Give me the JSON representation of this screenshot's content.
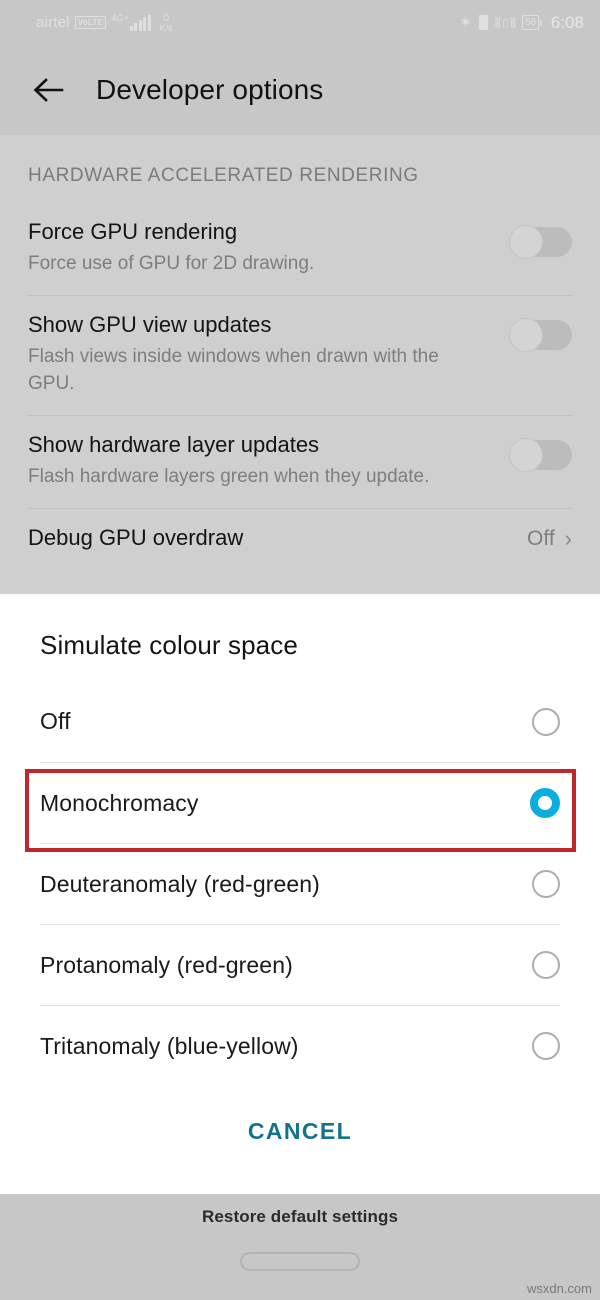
{
  "status_bar": {
    "carrier": "airtel",
    "volte_badge": "VoLTE",
    "network_type": "4G+",
    "data_speed_value": "0",
    "data_speed_unit": "K/s",
    "bluetooth_icon": "bluetooth-icon",
    "sim_icon": "sim-card-icon",
    "vibrate_icon": "vibrate-icon",
    "battery_level": "58",
    "clock": "6:08"
  },
  "app_bar": {
    "back_icon": "back-arrow-icon",
    "title": "Developer options"
  },
  "settings": {
    "section_header": "HARDWARE ACCELERATED RENDERING",
    "rows": [
      {
        "title": "Force GPU rendering",
        "subtitle": "Force use of GPU for 2D drawing.",
        "control": "toggle",
        "state": "off"
      },
      {
        "title": "Show GPU view updates",
        "subtitle": "Flash views inside windows when drawn with the GPU.",
        "control": "toggle",
        "state": "off"
      },
      {
        "title": "Show hardware layer updates",
        "subtitle": "Flash hardware layers green when they update.",
        "control": "toggle",
        "state": "off"
      },
      {
        "title": "Debug GPU overdraw",
        "subtitle": "",
        "control": "value",
        "value": "Off",
        "chevron": "chevron-right-icon"
      }
    ]
  },
  "dialog": {
    "title": "Simulate colour space",
    "options": [
      {
        "label": "Off",
        "selected": false
      },
      {
        "label": "Monochromacy",
        "selected": true
      },
      {
        "label": "Deuteranomaly (red-green)",
        "selected": false
      },
      {
        "label": "Protanomaly (red-green)",
        "selected": false
      },
      {
        "label": "Tritanomaly (blue-yellow)",
        "selected": false
      }
    ],
    "cancel_label": "CANCEL",
    "selected_value": "Monochromacy"
  },
  "footer": {
    "restore_label": "Restore default settings",
    "home_indicator": "home-indicator",
    "watermark": "wsxdn.com"
  },
  "colors": {
    "accent_selected_radio": "#0aaede",
    "cancel_text": "#12738e",
    "highlight_box": "#c0272d",
    "chrome_background": "#c7c7c7",
    "list_background": "#cfcfcf",
    "dialog_background": "#ffffff"
  }
}
